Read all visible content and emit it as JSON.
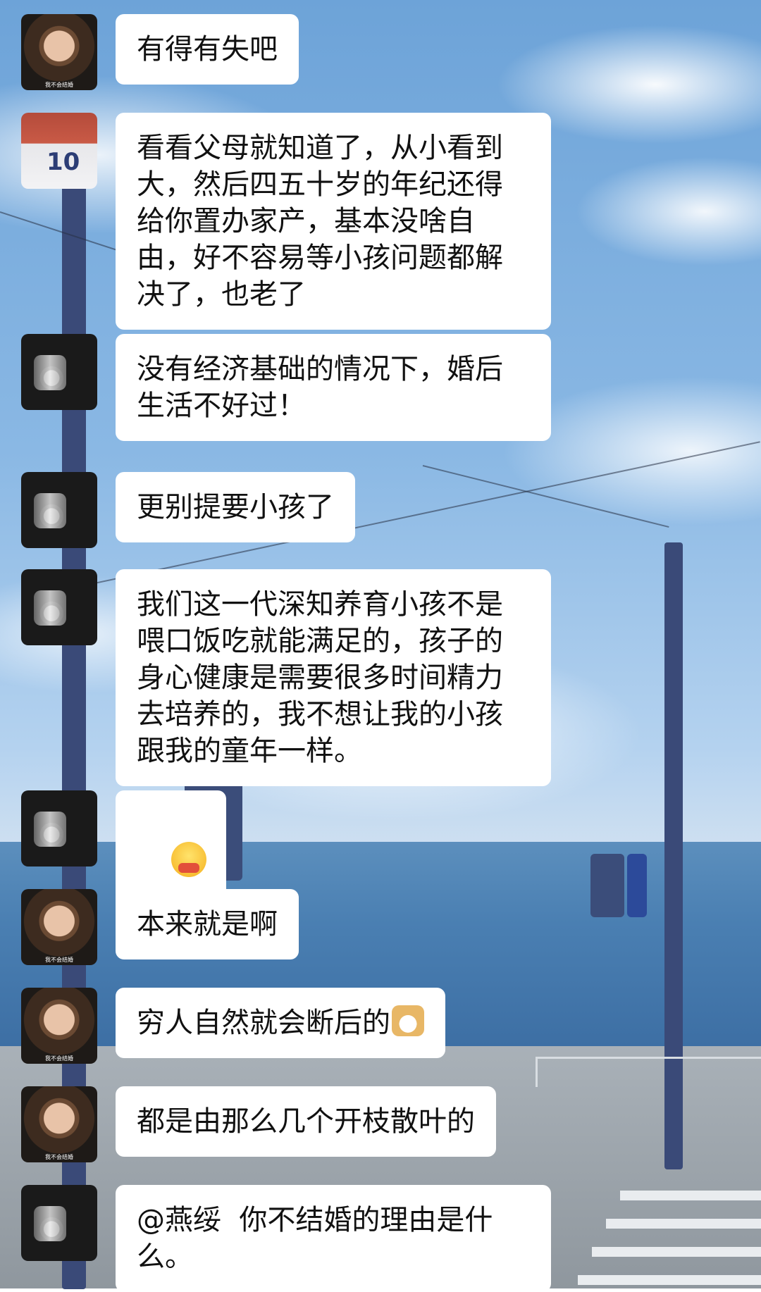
{
  "messages": [
    {
      "avatar": "boy-avatar",
      "text": "有得有失吧"
    },
    {
      "avatar": "player-avatar",
      "text": "看看父母就知道了，从小看到大，然后四五十岁的年纪还得给你置办家产，基本没啥自由，好不容易等小孩问题都解决了，也老了"
    },
    {
      "avatar": "drinker-avatar",
      "text": "没有经济基础的情况下，婚后生活不好过！"
    },
    {
      "avatar": "drinker-avatar",
      "text": "更别提要小孩了"
    },
    {
      "avatar": "drinker-avatar",
      "text": "我们这一代深知养育小孩不是喂口饭吃就能满足的，孩子的身心健康是需要很多时间精力去培养的，我不想让我的小孩跟我的童年一样。"
    },
    {
      "avatar": "drinker-avatar",
      "emoji": "eating-face-emoji"
    },
    {
      "avatar": "boy-avatar",
      "text": "本来就是啊"
    },
    {
      "avatar": "boy-avatar",
      "text": "穷人自然就会断后的",
      "emoji": "doge-emoji"
    },
    {
      "avatar": "boy-avatar",
      "text": "都是由那么几个开枝散叶的"
    },
    {
      "avatar": "drinker-avatar",
      "text": "@燕绥  你不结婚的理由是什么。"
    }
  ]
}
